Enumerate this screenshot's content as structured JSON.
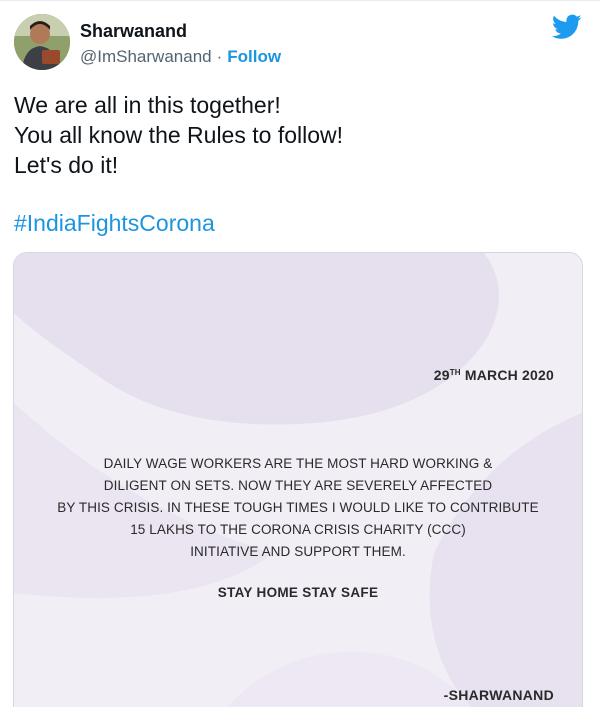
{
  "tweet": {
    "author": {
      "display_name": "Sharwanand",
      "handle": "@ImSharwanand",
      "separator": "·",
      "follow_label": "Follow"
    },
    "text_lines": [
      "We are all in this together!",
      "You all know the Rules to follow!",
      "Let's do it!"
    ],
    "hashtag": "#IndiaFightsCorona",
    "icons": {
      "brand": "twitter-bird-icon"
    },
    "colors": {
      "link": "#1b95e0",
      "text": "#0f1419",
      "muted": "#536471",
      "card_bg": "#efebf5"
    }
  },
  "notice": {
    "date_day": "29",
    "date_suffix": "TH",
    "date_rest": "MARCH 2020",
    "body_lines": [
      "DAILY WAGE WORKERS ARE THE MOST HARD WORKING &",
      "DILIGENT ON SETS. NOW THEY ARE SEVERELY AFFECTED",
      "BY THIS CRISIS. IN THESE TOUGH TIMES I WOULD LIKE TO CONTRIBUTE",
      "15 LAKHS TO THE CORONA CRISIS CHARITY (CCC)",
      "INITIATIVE AND SUPPORT THEM."
    ],
    "slogan": "STAY HOME STAY SAFE",
    "signature": "-SHARWANAND"
  }
}
